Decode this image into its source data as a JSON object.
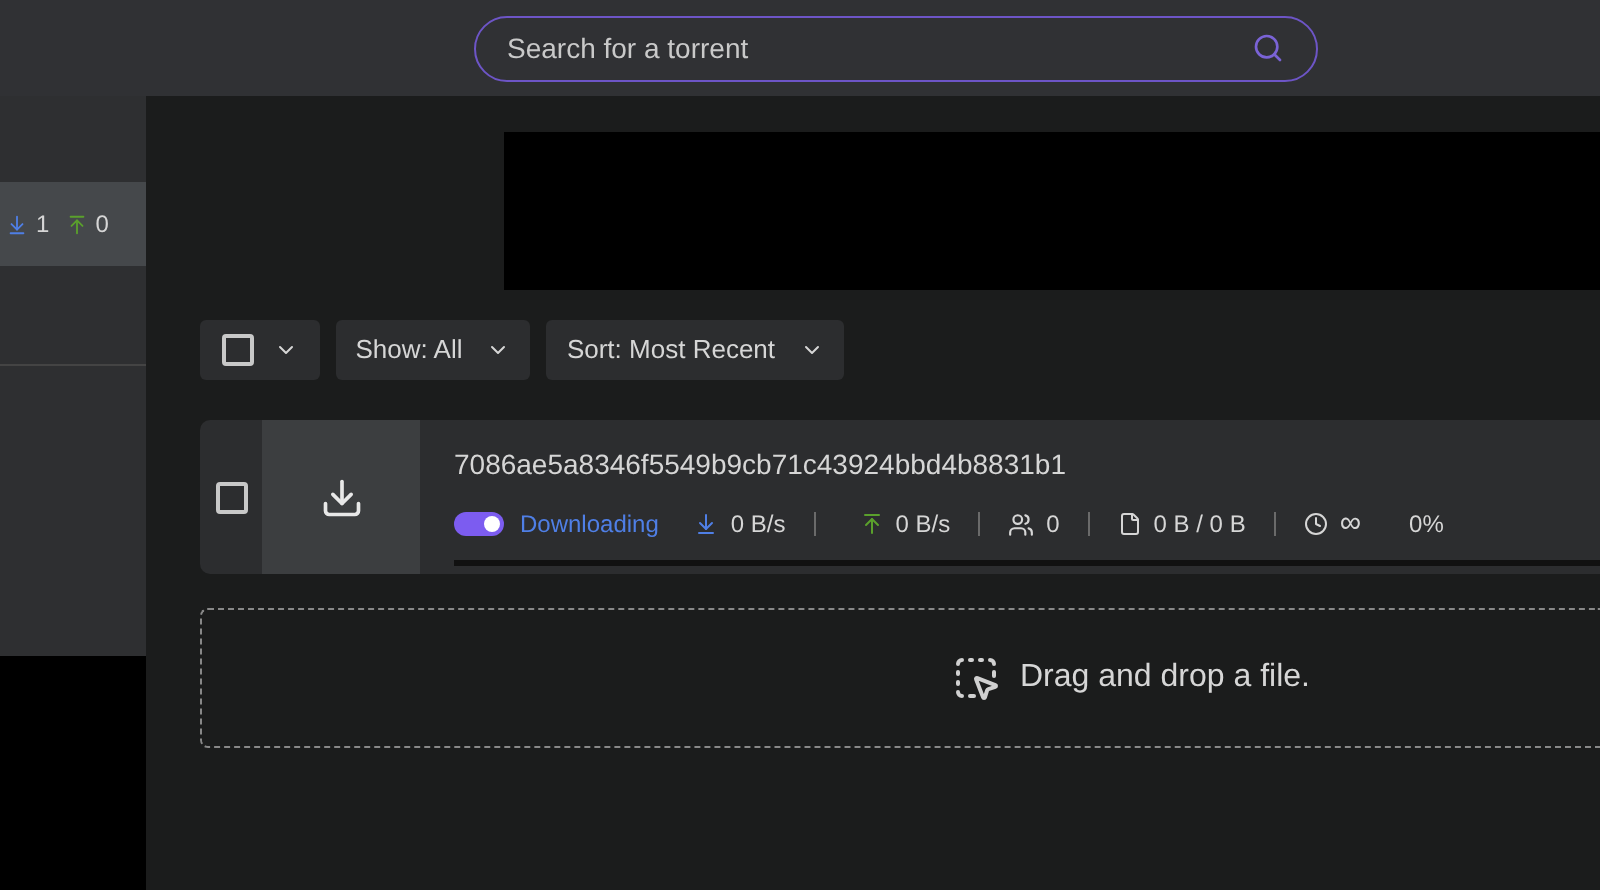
{
  "search": {
    "placeholder": "Search for a torrent"
  },
  "sidebar": {
    "items": [
      {
        "download_count": "1",
        "upload_count": "0",
        "selected": true
      }
    ]
  },
  "toolbar": {
    "select_all": {
      "checked": false
    },
    "show": {
      "label": "Show:",
      "value": "All"
    },
    "sort": {
      "label": "Sort:",
      "value": "Most Recent"
    }
  },
  "torrents": [
    {
      "name": "7086ae5a8346f5549b9cb71c43924bbd4b8831b1",
      "checked": false,
      "on": true,
      "status": "Downloading",
      "download_speed": "0 B/s",
      "upload_speed": "0 B/s",
      "peers": "0",
      "size": "0 B / 0 B",
      "eta": "∞",
      "percent": "0%",
      "level": 0
    }
  ],
  "dropzone": {
    "text": "Drag and drop a file."
  }
}
